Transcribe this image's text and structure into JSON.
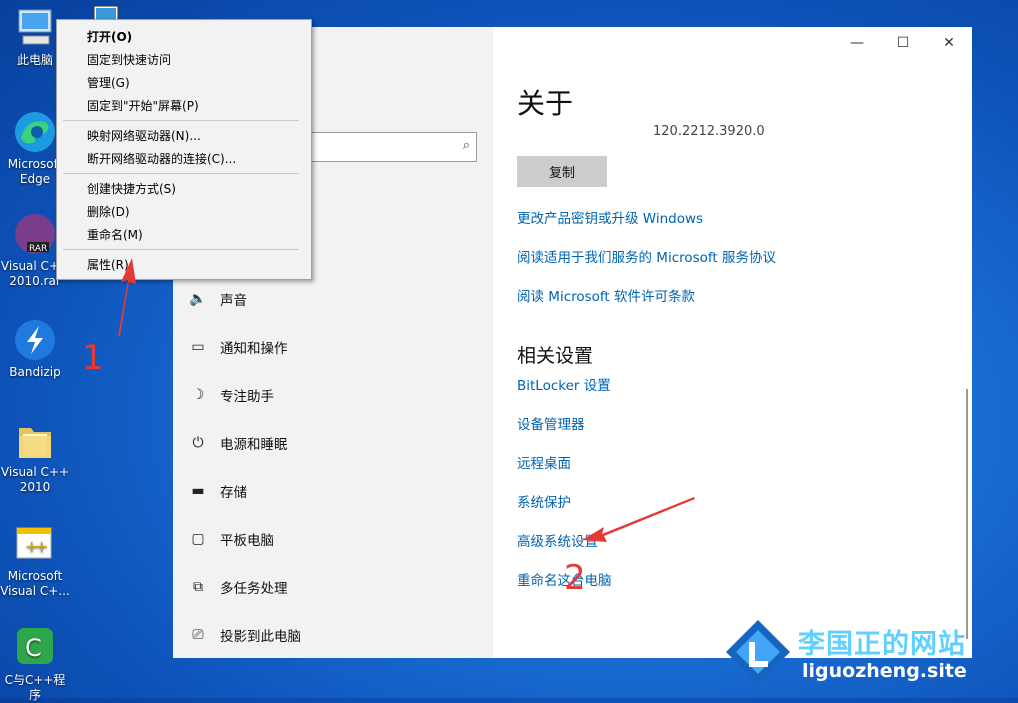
{
  "desktop": {
    "icons": [
      {
        "name": "pc-icon",
        "label": "此电脑"
      },
      {
        "name": "edge-icon",
        "label": "Microsoft Edge"
      },
      {
        "name": "rar-icon",
        "label": "Visual C++ 2010.rar"
      },
      {
        "name": "bandizip-icon",
        "label": "Bandizip"
      },
      {
        "name": "folder-icon",
        "label": "Visual C++ 2010"
      },
      {
        "name": "vc-icon",
        "label": "Microsoft Visual C+..."
      },
      {
        "name": "c-program-icon",
        "label": "C与C++程序"
      }
    ]
  },
  "context_menu": {
    "items": [
      "打开(O)",
      "固定到快速访问",
      "管理(G)",
      "固定到\"开始\"屏幕(P)",
      "映射网络驱动器(N)...",
      "断开网络驱动器的连接(C)...",
      "创建快捷方式(S)",
      "删除(D)",
      "重命名(M)",
      "属性(R)"
    ]
  },
  "settings": {
    "window_controls": {
      "minimize": "—",
      "maximize": "☐",
      "close": "✕"
    },
    "search_icon": "⌕",
    "nav": [
      {
        "label": "声音",
        "icon": "speaker-icon"
      },
      {
        "label": "通知和操作",
        "icon": "notification-icon"
      },
      {
        "label": "专注助手",
        "icon": "moon-icon"
      },
      {
        "label": "电源和睡眠",
        "icon": "power-icon"
      },
      {
        "label": "存储",
        "icon": "storage-icon"
      },
      {
        "label": "平板电脑",
        "icon": "tablet-icon"
      },
      {
        "label": "多任务处理",
        "icon": "multitask-icon"
      },
      {
        "label": "投影到此电脑",
        "icon": "project-icon"
      }
    ],
    "about_title": "关于",
    "version": "120.2212.3920.0",
    "copy_button": "复制",
    "links": [
      "更改产品密钥或升级 Windows",
      "阅读适用于我们服务的 Microsoft 服务协议",
      "阅读 Microsoft 软件许可条款"
    ],
    "related_title": "相关设置",
    "related_links": [
      "BitLocker 设置",
      "设备管理器",
      "远程桌面",
      "系统保护",
      "高级系统设置",
      "重命名这台电脑"
    ]
  },
  "annotations": {
    "one": "1",
    "two": "2"
  },
  "watermark": {
    "title": "李国正的网站",
    "url": "liguozheng.site"
  }
}
